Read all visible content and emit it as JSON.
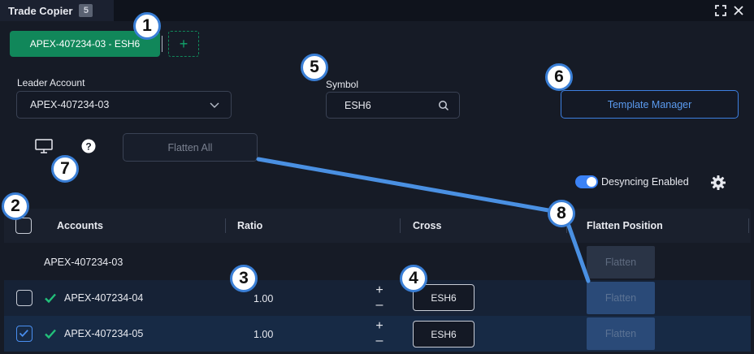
{
  "window": {
    "title": "Trade Copier",
    "badge": "5",
    "icons": [
      "expand-icon",
      "close-icon"
    ]
  },
  "copier_tabs": {
    "active_label": "APEX-407234-03 - ESH6",
    "add_label": "+"
  },
  "leader": {
    "label": "Leader Account",
    "value": "APEX-407234-03"
  },
  "symbol": {
    "label": "Symbol",
    "value": "ESH6"
  },
  "template_manager": {
    "label": "Template Manager"
  },
  "flatten_all": {
    "label": "Flatten All"
  },
  "help": {
    "glyph": "?"
  },
  "desync": {
    "label": "Desyncing Enabled",
    "enabled": true
  },
  "table": {
    "columns": [
      "Accounts",
      "Ratio",
      "Cross",
      "Flatten Position"
    ],
    "leader_row": {
      "account": "APEX-407234-03",
      "flatten": "Flatten"
    },
    "rows": [
      {
        "account": "APEX-407234-04",
        "checked": false,
        "ratio": "1.00",
        "plus": "+",
        "minus": "–",
        "cross": "ESH6",
        "flatten": "Flatten"
      },
      {
        "account": "APEX-407234-05",
        "checked": true,
        "ratio": "1.00",
        "plus": "+",
        "minus": "–",
        "cross": "ESH6",
        "flatten": "Flatten"
      }
    ]
  },
  "callouts": [
    "1",
    "2",
    "3",
    "4",
    "5",
    "6",
    "7",
    "8"
  ],
  "colors": {
    "background": "#161b26",
    "accent_green": "#11875a",
    "accent_blue": "#3b82f6",
    "callout_border": "#3a7fd6",
    "flatten_button": "#2a4a78"
  }
}
